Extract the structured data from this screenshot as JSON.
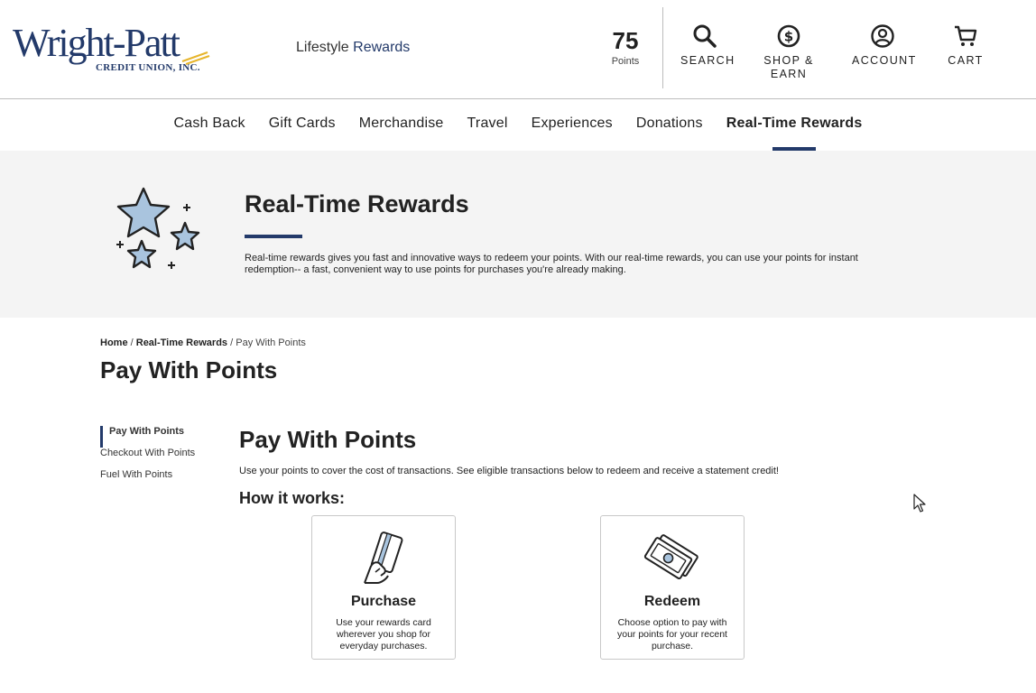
{
  "brand": {
    "logo_text": "Wright-Patt",
    "logo_subtext": "CREDIT UNION, INC.",
    "program_prefix": "Lifestyle",
    "program_suffix": "Rewards",
    "accent_color": "#233a6a"
  },
  "header": {
    "points_value": "75",
    "points_label": "Points",
    "nav": [
      {
        "label": "SEARCH",
        "icon": "search-icon"
      },
      {
        "label": "SHOP &\nEARN",
        "icon": "dollar-circle-icon"
      },
      {
        "label": "ACCOUNT",
        "icon": "account-icon"
      },
      {
        "label": "CART",
        "icon": "cart-icon"
      }
    ]
  },
  "categories": [
    {
      "label": "Cash Back"
    },
    {
      "label": "Gift Cards"
    },
    {
      "label": "Merchandise"
    },
    {
      "label": "Travel"
    },
    {
      "label": "Experiences"
    },
    {
      "label": "Donations"
    },
    {
      "label": "Real-Time Rewards",
      "active": true
    }
  ],
  "banner": {
    "title": "Real-Time Rewards",
    "description": "Real-time rewards gives you fast and innovative ways to redeem your points. With our real-time rewards, you can use your points for instant redemption-- a fast, convenient way to use points for purchases you're already making.",
    "icon": "stars-icon"
  },
  "breadcrumb": {
    "home": "Home",
    "section": "Real-Time Rewards",
    "current": "Pay With Points",
    "sep": "/"
  },
  "page_title": "Pay With Points",
  "side_nav": [
    {
      "label": "Pay With Points",
      "active": true
    },
    {
      "label": "Checkout With Points"
    },
    {
      "label": "Fuel With Points"
    }
  ],
  "main": {
    "heading": "Pay With Points",
    "description": "Use your points to cover the cost of transactions. See eligible transactions below to redeem and receive a statement credit!",
    "how_heading": "How it works:",
    "steps": [
      {
        "title": "Purchase",
        "text": "Use your rewards card wherever you shop for everyday purchases.",
        "icon": "card-in-hand-icon"
      },
      {
        "title": "Redeem",
        "text": "Choose option to pay with your points for your recent purchase.",
        "icon": "cash-bills-icon"
      }
    ]
  }
}
